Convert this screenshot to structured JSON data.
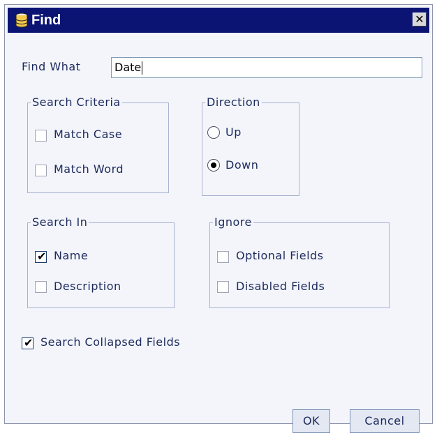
{
  "window": {
    "title": "Find",
    "close_glyph": "✕"
  },
  "find": {
    "label": "Find What",
    "value": "Date"
  },
  "search_criteria": {
    "legend": "Search Criteria",
    "options": [
      {
        "label": "Match Case",
        "checked": false
      },
      {
        "label": "Match Word",
        "checked": false
      }
    ]
  },
  "direction": {
    "legend": "Direction",
    "options": [
      {
        "label": "Up",
        "selected": false
      },
      {
        "label": "Down",
        "selected": true
      }
    ]
  },
  "search_in": {
    "legend": "Search In",
    "options": [
      {
        "label": "Name",
        "checked": true
      },
      {
        "label": "Description",
        "checked": false
      }
    ]
  },
  "ignore": {
    "legend": "Ignore",
    "options": [
      {
        "label": "Optional Fields",
        "checked": false
      },
      {
        "label": "Disabled Fields",
        "checked": false
      }
    ]
  },
  "collapsed": {
    "label": "Search Collapsed Fields",
    "checked": true
  },
  "check_glyph": "✔",
  "buttons": {
    "ok": "OK",
    "cancel": "Cancel"
  },
  "colors": {
    "titlebar": "#0b1473",
    "dialog_bg": "#f3f5fb",
    "text": "#1d2a5c"
  }
}
